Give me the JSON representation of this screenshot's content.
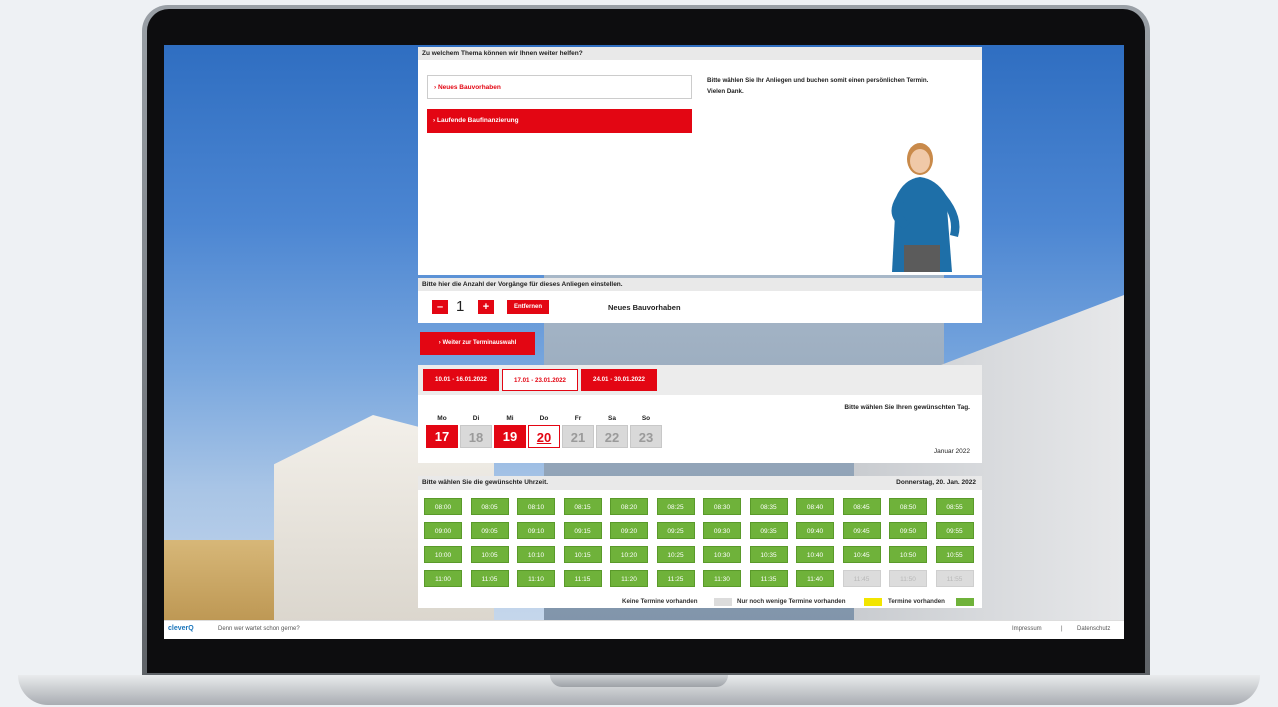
{
  "footer": {
    "logo": "cleverQ",
    "slogan": "Denn wer wartet schon gerne?",
    "impressum": "Impressum",
    "separator": "|",
    "datenschutz": "Datenschutz"
  },
  "topic_panel": {
    "header": "Zu welchem Thema können wir Ihnen weiter helfen?",
    "topics": [
      {
        "label": "Neues Bauvorhaben",
        "state": "outline"
      },
      {
        "label": "Laufende Baufinanzierung",
        "state": "filled"
      }
    ],
    "note_line1": "Bitte wählen Sie Ihr Anliegen und buchen somit einen persönlichen Termin.",
    "note_line2": "Vielen Dank."
  },
  "count_panel": {
    "header": "Bitte hier die Anzahl der Vorgänge für dieses Anliegen einstellen.",
    "minus": "–",
    "count": "1",
    "plus": "+",
    "remove": "Entfernen",
    "selected_topic": "Neues Bauvorhaben"
  },
  "continue_button": "Weiter zur Terminauswahl",
  "weeks": [
    {
      "label": "10.01 - 16.01.2022",
      "state": "filled"
    },
    {
      "label": "17.01 - 23.01.2022",
      "state": "outline"
    },
    {
      "label": "24.01 - 30.01.2022",
      "state": "filled"
    }
  ],
  "day_panel": {
    "instruction": "Bitte wählen Sie Ihren gewünschten Tag.",
    "month": "Januar 2022",
    "days": [
      {
        "name": "Mo",
        "num": "17",
        "state": "red"
      },
      {
        "name": "Di",
        "num": "18",
        "state": "gray"
      },
      {
        "name": "Mi",
        "num": "19",
        "state": "red"
      },
      {
        "name": "Do",
        "num": "20",
        "state": "sel"
      },
      {
        "name": "Fr",
        "num": "21",
        "state": "gray"
      },
      {
        "name": "Sa",
        "num": "22",
        "state": "gray"
      },
      {
        "name": "So",
        "num": "23",
        "state": "gray"
      }
    ]
  },
  "time_panel": {
    "header": "Bitte wählen Sie die gewünschte Uhrzeit.",
    "date": "Donnerstag, 20. Jan. 2022",
    "rows": [
      [
        "08:00",
        "08:05",
        "08:10",
        "08:15",
        "08:20",
        "08:25",
        "08:30",
        "08:35",
        "08:40",
        "08:45",
        "08:50",
        "08:55"
      ],
      [
        "09:00",
        "09:05",
        "09:10",
        "09:15",
        "09:20",
        "09:25",
        "09:30",
        "09:35",
        "09:40",
        "09:45",
        "09:50",
        "09:55"
      ],
      [
        "10:00",
        "10:05",
        "10:10",
        "10:15",
        "10:20",
        "10:25",
        "10:30",
        "10:35",
        "10:40",
        "10:45",
        "10:50",
        "10:55"
      ],
      [
        "11:00",
        "11:05",
        "11:10",
        "11:15",
        "11:20",
        "11:25",
        "11:30",
        "11:35",
        "11:40",
        "11:45",
        "11:50",
        "11:55"
      ]
    ],
    "unavailable": [
      "11:45",
      "11:50",
      "11:55"
    ],
    "legend": {
      "none": "Keine Termine vorhanden",
      "few": "Nur noch wenige Termine vorhanden",
      "avail": "Termine vorhanden"
    }
  },
  "colors": {
    "accent_red": "#e30613",
    "slot_green": "#6fb23a",
    "few_yellow": "#f2e500",
    "none_gray": "#dcdcdc"
  }
}
